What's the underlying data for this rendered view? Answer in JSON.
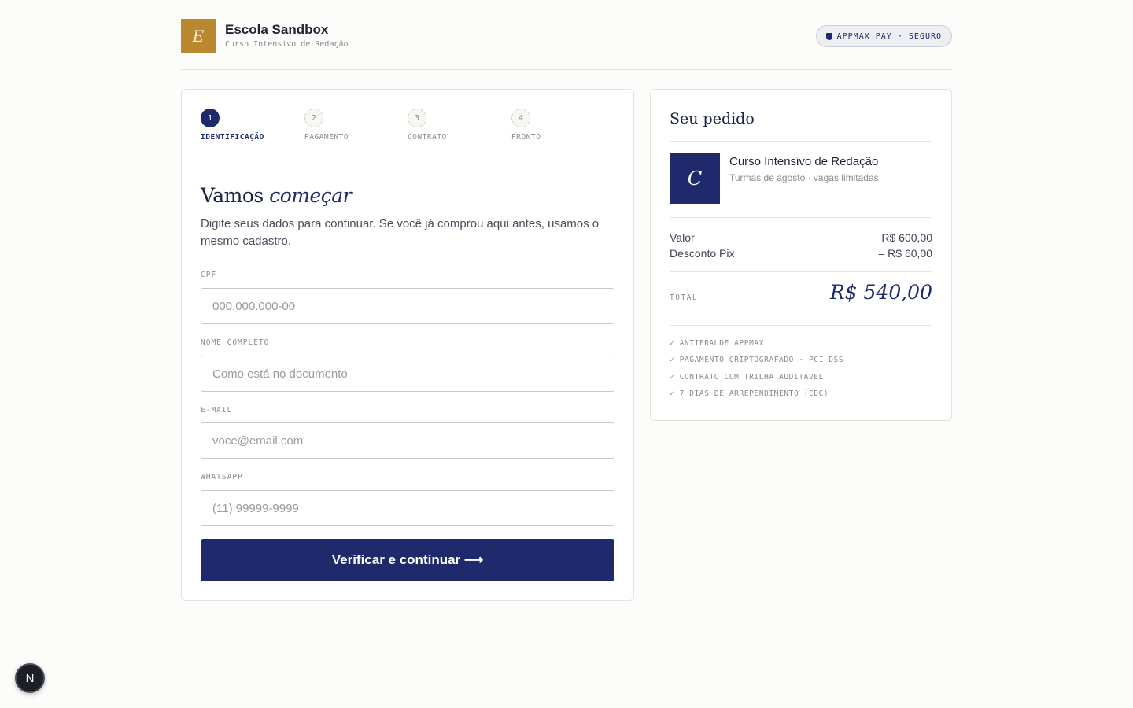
{
  "brand": {
    "logo_letter": "E",
    "name": "Escola Sandbox",
    "subtitle": "Curso Intensivo de Redação",
    "secure_badge": "APPMAX PAY · SEGURO"
  },
  "stepper": {
    "steps": [
      {
        "number": "1",
        "label": "IDENTIFICAÇÃO",
        "active": true
      },
      {
        "number": "2",
        "label": "PAGAMENTO",
        "active": false
      },
      {
        "number": "3",
        "label": "CONTRATO",
        "active": false
      },
      {
        "number": "4",
        "label": "PRONTO",
        "active": false
      }
    ]
  },
  "form": {
    "title_plain": "Vamos ",
    "title_emphasis": "começar",
    "description": "Digite seus dados para continuar. Se você já comprou aqui antes, usamos o mesmo cadastro.",
    "fields": {
      "cpf": {
        "label": "CPF",
        "placeholder": "000.000.000-00",
        "value": ""
      },
      "nome": {
        "label": "NOME COMPLETO",
        "placeholder": "Como está no documento",
        "value": ""
      },
      "email": {
        "label": "E-MAIL",
        "placeholder": "voce@email.com",
        "value": ""
      },
      "whatsapp": {
        "label": "WHATSAPP",
        "placeholder": "(11) 99999-9999",
        "value": ""
      }
    },
    "submit_label": "Verificar e continuar ⟶"
  },
  "order": {
    "title": "Seu pedido",
    "product": {
      "thumb_letter": "C",
      "name": "Curso Intensivo de Redação",
      "subtitle": "Turmas de agosto · vagas limitadas"
    },
    "lines": [
      {
        "label": "Valor",
        "amount": "R$ 600,00"
      },
      {
        "label": "Desconto Pix",
        "amount": "– R$ 60,00"
      }
    ],
    "total_label": "TOTAL",
    "total_value": "R$ 540,00",
    "trust_items": [
      "✓ ANTIFRAUDE APPMAX",
      "✓ PAGAMENTO CRIPTOGRAFADO · PCI DSS",
      "✓ CONTRATO COM TRILHA AUDITÁVEL",
      "✓ 7 DIAS DE ARREPENDIMENTO (CDC)"
    ]
  },
  "dev_badge": {
    "letter": "N"
  },
  "colors": {
    "primary": "#1e2a6b",
    "brand_gold": "#b9882f",
    "background": "#fcfcfa"
  }
}
